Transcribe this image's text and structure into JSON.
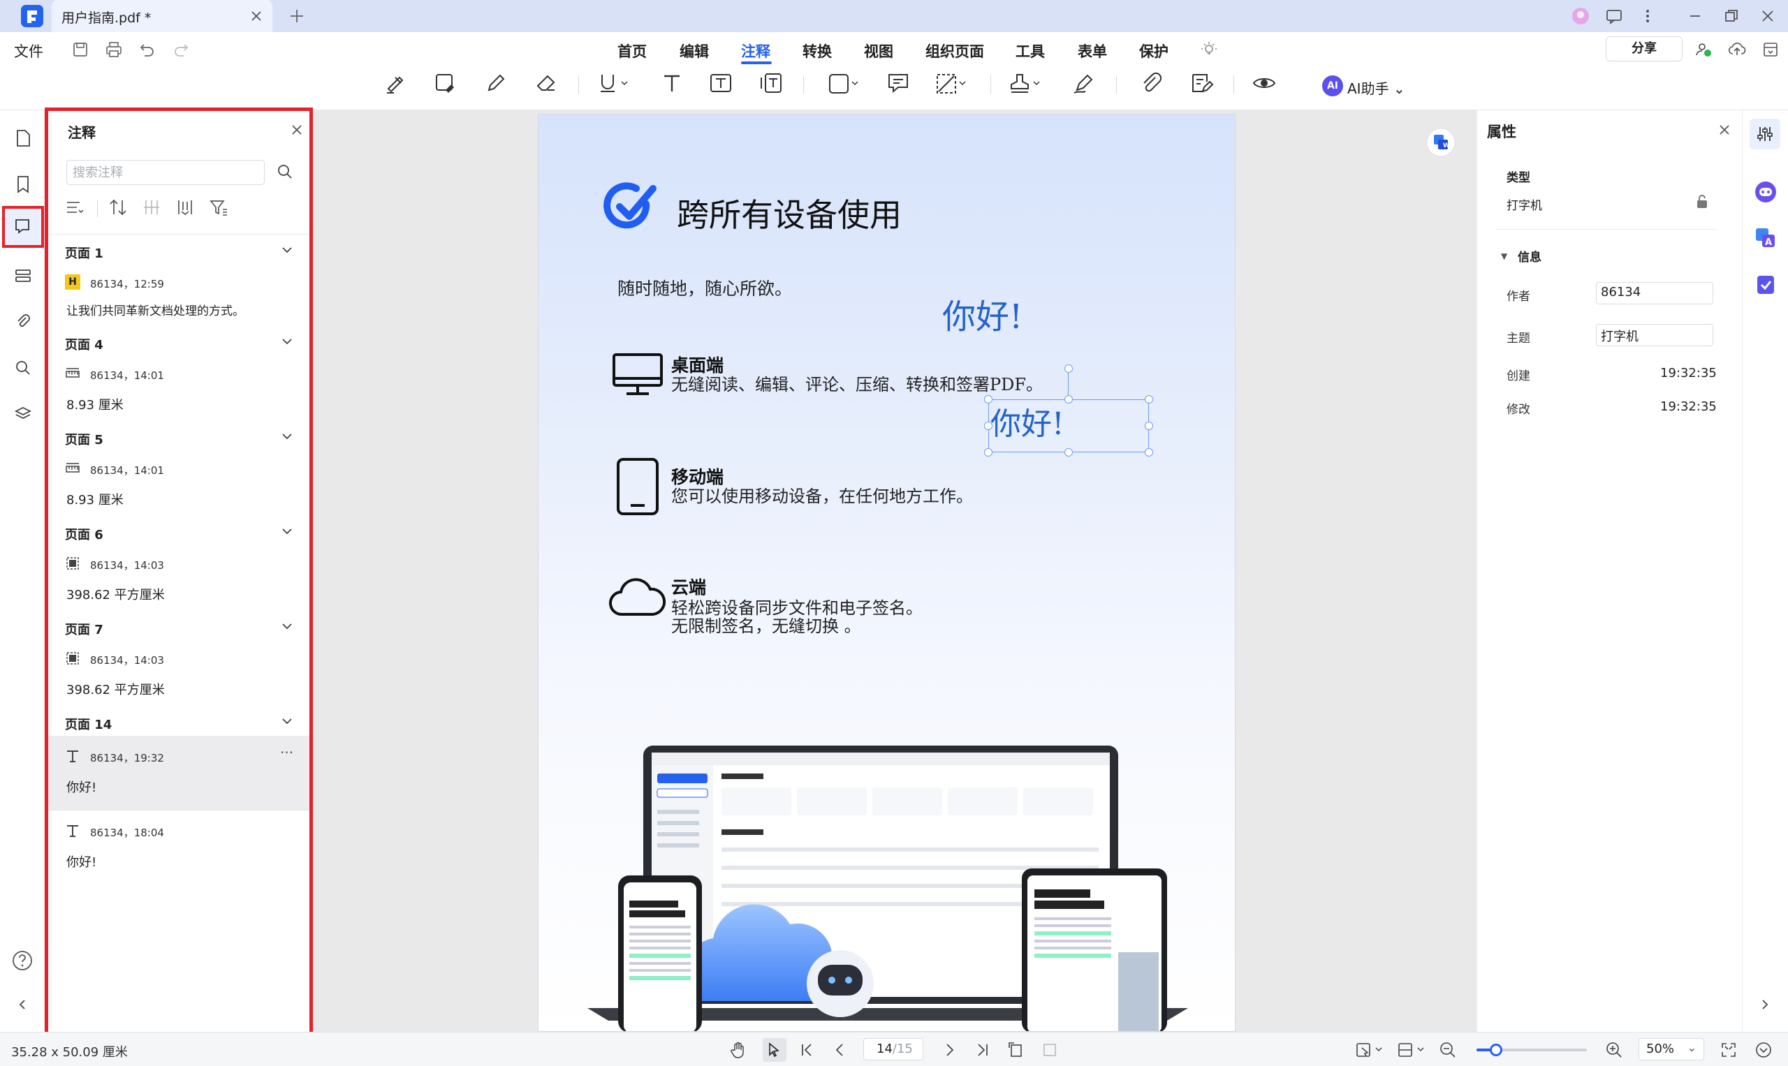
{
  "titlebar": {
    "doc_tab": "用户指南.pdf *"
  },
  "menubar": {
    "file": "文件",
    "menus": [
      "首页",
      "编辑",
      "注释",
      "转换",
      "视图",
      "组织页面",
      "工具",
      "表单",
      "保护"
    ],
    "active_menu": "注释",
    "share": "分享",
    "ai_badge": "AI",
    "ai_label": "AI助手"
  },
  "comments_panel": {
    "title": "注释",
    "search_placeholder": "搜索注释",
    "groups": [
      {
        "title": "页面 1",
        "items": [
          {
            "icon": "highlight-icon",
            "icon_text": "H",
            "meta": "86134，12:59",
            "text": "让我们共同革新文档处理的方式。"
          }
        ]
      },
      {
        "title": "页面 4",
        "items": [
          {
            "icon": "measure-distance-icon",
            "meta": "86134，14:01",
            "text": "8.93 厘米"
          }
        ]
      },
      {
        "title": "页面 5",
        "items": [
          {
            "icon": "measure-distance-icon",
            "meta": "86134，14:01",
            "text": "8.93 厘米"
          }
        ]
      },
      {
        "title": "页面 6",
        "items": [
          {
            "icon": "measure-area-icon",
            "meta": "86134，14:03",
            "text": "398.62 平方厘米"
          }
        ]
      },
      {
        "title": "页面 7",
        "items": [
          {
            "icon": "measure-area-icon",
            "meta": "86134，14:03",
            "text": "398.62 平方厘米"
          }
        ]
      },
      {
        "title": "页面 14",
        "items": [
          {
            "icon": "text-icon",
            "meta": "86134，19:32",
            "text": "你好!",
            "selected": true,
            "more": "···"
          },
          {
            "icon": "text-icon",
            "meta": "86134，18:04",
            "text": "你好!"
          }
        ]
      }
    ]
  },
  "document": {
    "title": "跨所有设备使用",
    "subtitle": "随时随地，随心所欲。",
    "sections": [
      {
        "icon": "monitor-icon",
        "heading": "桌面端",
        "body": "无缝阅读、编辑、评论、压缩、转换和签署PDF。"
      },
      {
        "icon": "phone-icon",
        "heading": "移动端",
        "body": "您可以使用移动设备，在任何地方工作。"
      },
      {
        "icon": "cloud-icon",
        "heading": "云端",
        "body": "轻松跨设备同步文件和电子签名。\n无限制签名，无缝切换 。"
      }
    ],
    "handwriting_1": "你好!",
    "handwriting_2": "你好!"
  },
  "properties": {
    "title": "属性",
    "type_label": "类型",
    "type_value": "打字机",
    "info_label": "信息",
    "author_label": "作者",
    "author_value": "86134",
    "subject_label": "主题",
    "subject_value": "打字机",
    "created_label": "创建",
    "created_value": "19:32:35",
    "modified_label": "修改",
    "modified_value": "19:32:35"
  },
  "statusbar": {
    "page_size": "35.28 x 50.09 厘米",
    "current_page": "14",
    "total_pages": "/15",
    "zoom": "50%",
    "zoom_fraction": 0.18
  },
  "colors": {
    "accent": "#2662f0",
    "highlight_border": "#e6212a"
  }
}
